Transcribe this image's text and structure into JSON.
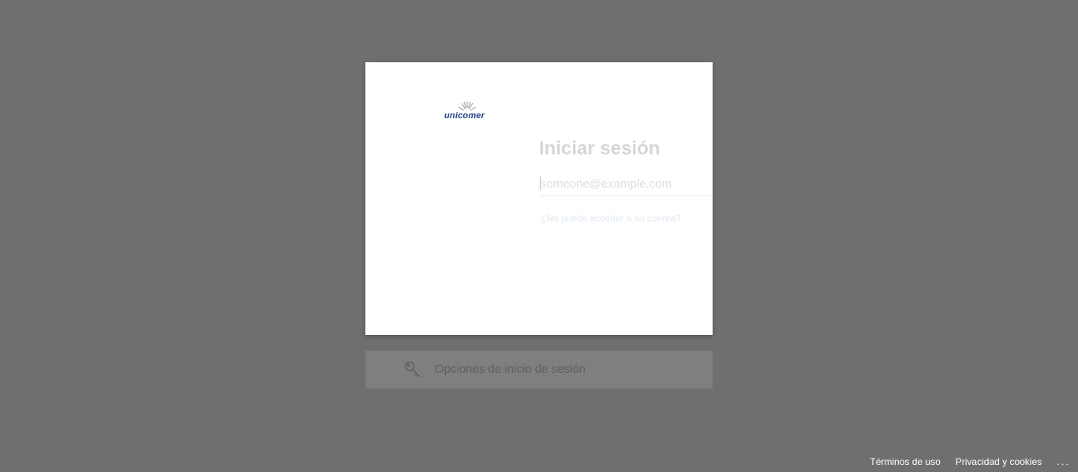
{
  "brand": {
    "logo_text": "unicomer",
    "logo_color": "#1f3f8f"
  },
  "signin": {
    "title": "Iniciar sesión",
    "email_placeholder": "someone@example.com",
    "email_value": "",
    "cant_access_link": "¿No puede acceder a su cuenta?"
  },
  "options": {
    "label": "Opciones de inicio de sesión",
    "icon": "key-icon"
  },
  "footer": {
    "terms": "Términos de uso",
    "privacy": "Privacidad y cookies",
    "more": "..."
  },
  "colors": {
    "background": "#6f6f6f",
    "card": "#ffffff",
    "options_bar": "#7f7f7f"
  }
}
